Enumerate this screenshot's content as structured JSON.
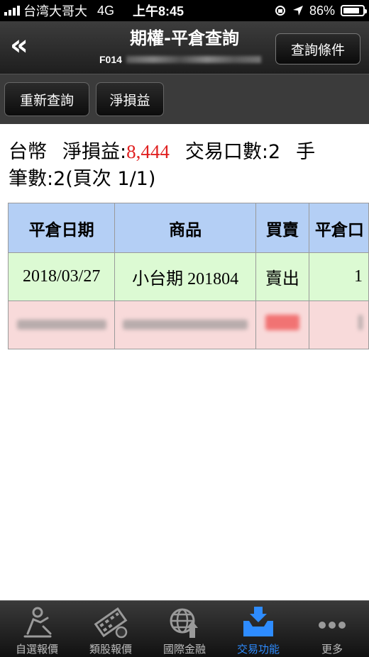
{
  "status_bar": {
    "carrier": "台湾大哥大",
    "network": "4G",
    "time": "上午8:45",
    "battery": "86%",
    "battery_level": 0.86
  },
  "header": {
    "back_label": "«",
    "title": "期權-平倉查詢",
    "account_prefix": "F014",
    "query_conditions_label": "查詢條件"
  },
  "toolbar": {
    "requery_label": "重新查詢",
    "net_pl_label": "淨損益"
  },
  "summary": {
    "currency": "台幣",
    "net_pl_label": "淨損益:",
    "net_pl_value": "8,444",
    "lots_label": "交易口數:2",
    "truncated_text": "手",
    "count_label": "筆數:2(頁次 1/1)"
  },
  "table": {
    "headers": [
      "平倉日期",
      "商品",
      "買賣",
      "平倉口"
    ],
    "rows": [
      {
        "date": "2018/03/27",
        "product": "小台期 201804",
        "side": "賣出",
        "qty": "1"
      }
    ]
  },
  "tabbar": {
    "items": [
      {
        "label": "自選報價",
        "icon": "watchlist-icon",
        "active": false
      },
      {
        "label": "類股報價",
        "icon": "sector-quote-icon",
        "active": false
      },
      {
        "label": "國際金融",
        "icon": "globe-finance-icon",
        "active": false
      },
      {
        "label": "交易功能",
        "icon": "trade-function-icon",
        "active": true
      },
      {
        "label": "更多",
        "icon": "more-icon",
        "active": false
      }
    ]
  },
  "colors": {
    "header_bg": "#2b2b2b",
    "table_header_bg": "#b4cff5",
    "buy_sell_row_green": "#dcfad3",
    "row_pink": "#f8dada",
    "net_pl_red": "#e02020",
    "sell_green": "#1e9a1e",
    "tab_active": "#2e8cff"
  }
}
